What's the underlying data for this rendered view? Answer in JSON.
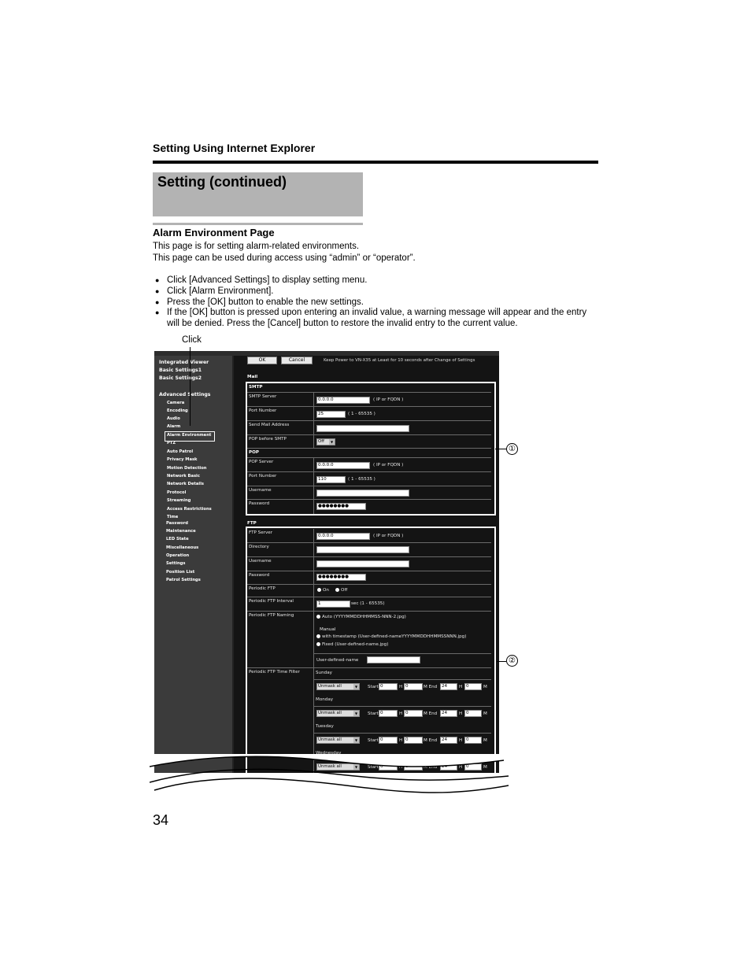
{
  "header": {
    "section": "Setting Using Internet Explorer"
  },
  "title": "Setting (continued)",
  "subheading": "Alarm Environment Page",
  "intro": [
    "This page is for setting alarm-related environments.",
    "This page can be used during access using “admin” or “operator”."
  ],
  "bullets": [
    "Click [Advanced Settings] to display setting menu.",
    "Click [Alarm Environment].",
    "Press the [OK] button to enable the new settings.",
    "If the [OK] button is pressed upon entering an invalid value, a warning message will appear and the entry will be denied. Press the [Cancel] button to restore the invalid entry to the current value."
  ],
  "click_label": "Click",
  "page_number": "34",
  "callouts": [
    "①",
    "②"
  ],
  "screenshot": {
    "sidebar": {
      "top_items": [
        "Integrated Viewer",
        "Basic Settings1",
        "Basic Settings2"
      ],
      "advanced": "Advanced Settings",
      "sub_items": [
        "Camera",
        "Encoding",
        "Audio",
        "Alarm",
        "Alarm Environment",
        "PTZ",
        "Auto Patrol",
        "Privacy Mask",
        "Motion Detection",
        "Network Basic",
        "Network Details",
        "Protocol",
        "Streaming",
        "Access Restrictions",
        "Time",
        "Password",
        "Maintenance",
        "LED State",
        "Miscellaneous",
        "Operation",
        "Settings",
        "Position List",
        "Patrol Settings"
      ]
    },
    "buttons": {
      "ok": "OK",
      "cancel": "Cancel"
    },
    "warning": "Keep Power to VN-X35 at Least for 10 seconds after Change of Settings",
    "mail": {
      "heading": "Mail",
      "smtp_heading": "SMTP",
      "smtp_server": {
        "label": "SMTP Server",
        "value": "0.0.0.0",
        "hint": "( IP or FQDN )"
      },
      "port": {
        "label": "Port Number",
        "value": "25",
        "hint": "( 1 - 65535 )"
      },
      "send_address": {
        "label": "Send Mail Address",
        "value": ""
      },
      "pop_before": {
        "label": "POP before SMTP",
        "value": "Off"
      },
      "pop_heading": "POP",
      "pop_server": {
        "label": "POP Server",
        "value": "0.0.0.0",
        "hint": "( IP or FQDN )"
      },
      "pop_port": {
        "label": "Port Number",
        "value": "110",
        "hint": "( 1 - 65535 )"
      },
      "username": {
        "label": "Username",
        "value": ""
      },
      "password": {
        "label": "Password",
        "value": "●●●●●●●●"
      }
    },
    "ftp": {
      "heading": "FTP",
      "server": {
        "label": "FTP Server",
        "value": "0.0.0.0",
        "hint": "( IP or FQDN )"
      },
      "directory": {
        "label": "Directory",
        "value": ""
      },
      "username": {
        "label": "Username",
        "value": ""
      },
      "password": {
        "label": "Password",
        "value": "●●●●●●●●"
      },
      "periodic": {
        "label": "Periodic FTP",
        "on": "On",
        "off": "Off"
      },
      "interval": {
        "label": "Periodic FTP Interval",
        "value": "1",
        "hint": "sec (1 - 65535)"
      },
      "naming": {
        "label": "Periodic FTP Naming",
        "auto": "Auto (YYYYMMDDHHMMSS-NNN-2.jpg)",
        "manual": "Manual",
        "with_ts": "with timestamp (User-defined-nameYYYYMMDDHHMMSSNNN.jpg)",
        "fixed": "Fixed   (User-defined-name.jpg)",
        "user_defined": "User-defined-name"
      },
      "filter": {
        "label": "Periodic FTP Time Filter",
        "days": [
          "Sunday",
          "Monday",
          "Tuesday",
          "Wednesday"
        ],
        "mask": "Unmask all",
        "start": "Start",
        "h": "H",
        "m_end": "M End",
        "m": "M",
        "start_h": "0",
        "start_m": "0",
        "end_h": "24",
        "end_m": "0"
      }
    }
  }
}
